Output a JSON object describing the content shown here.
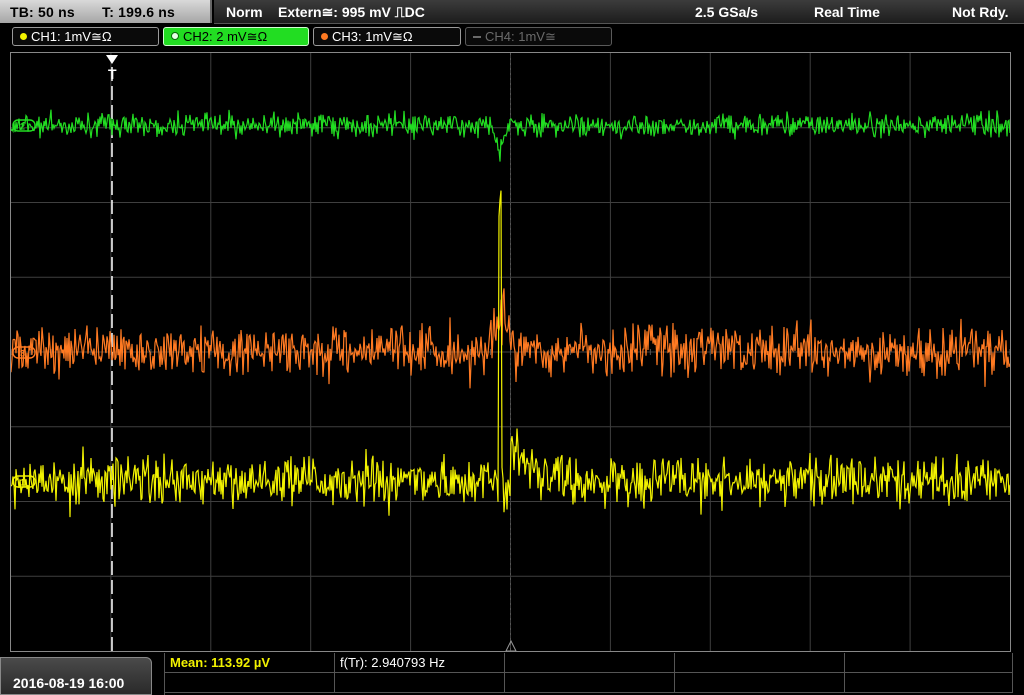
{
  "header": {
    "timebase": "TB: 50 ns",
    "trigger_time": "T: 199.6 ns",
    "acq_mode": "Norm",
    "trigger_info": "Extern≅: 995 mV ⎍DC",
    "sample_rate": "2.5 GSa/s",
    "time_mode": "Real Time",
    "status": "Not Rdy."
  },
  "channels": [
    {
      "label": "CH1: 1mV≅Ω",
      "color": "#f2f200",
      "active": false,
      "enabled": true
    },
    {
      "label": "CH2: 2 mV≅Ω",
      "color": "#22dd22",
      "active": true,
      "enabled": true
    },
    {
      "label": "CH3: 1mV≅Ω",
      "color": "#ff7a22",
      "active": false,
      "enabled": true
    },
    {
      "label": "CH4: 1mV≅",
      "color": "#777777",
      "active": false,
      "enabled": false
    }
  ],
  "markers": {
    "trigger_marker": "T",
    "ch_ground_markers": [
      "2",
      "3",
      "1"
    ]
  },
  "footer": {
    "datetime": "2016-08-19 16:00",
    "measurement_1": "Mean: 113.92 µV",
    "measurement_2": "f(Tr): 2.940793 Hz"
  },
  "colors": {
    "ch1": "#f2f200",
    "ch2": "#22dd22",
    "ch3": "#ff7a22",
    "grid": "#444444",
    "measurement_highlight": "#f2f200"
  }
}
